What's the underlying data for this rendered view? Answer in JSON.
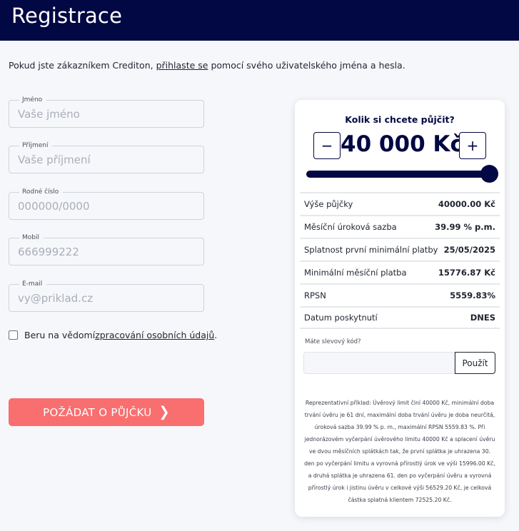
{
  "header": {
    "title": "Registrace"
  },
  "intro": {
    "before": "Pokud jste zákazníkem Crediton, ",
    "link": "přihlaste se",
    "after": " pomocí svého uživatelského jména a hesla."
  },
  "form": {
    "fields": [
      {
        "label": "Jméno",
        "placeholder": "Vaše jméno"
      },
      {
        "label": "Příjmení",
        "placeholder": "Vaše příjmení"
      },
      {
        "label": "Rodné číslo",
        "placeholder": "000000/0000"
      },
      {
        "label": "Mobil",
        "placeholder": "666999222"
      },
      {
        "label": "E-mail",
        "placeholder": "vy@priklad.cz"
      }
    ],
    "consent": {
      "before": "Beru na vědomí ",
      "link": "zpracování osobních údajů",
      "after": "."
    },
    "submit_label": "POŽÁDAT O PŮJČKU",
    "submit_chevron": "❯"
  },
  "calculator": {
    "question": "Kolik si chcete půjčit?",
    "minus": "−",
    "plus": "+",
    "amount": "40 000 Kč",
    "slider_level": 1.0,
    "rows": [
      {
        "label": "Výše půjčky",
        "value": "40000.00 Kč"
      },
      {
        "label": "Měsíční úroková sazba",
        "value": "39.99 % p.m."
      },
      {
        "label": "Splatnost první minimální platby",
        "value": "25/05/2025"
      },
      {
        "label": "Minimální měsíční platba",
        "value": "15776.87 Kč"
      },
      {
        "label": "RPSN",
        "value": "5559.83%"
      },
      {
        "label": "Datum poskytnutí",
        "value": "DNES"
      }
    ],
    "promo_label": "Máte slevový kód?",
    "promo_button": "Použít",
    "disclaimer": "Reprezentativní příklad: Úvěrový limit činí 40000 Kč, minimální doba trvání úvěru je 61 dní, maximální doba trvání úvěru je doba neurčitá, úroková sazba 39.99 % p. m., maximální RPSN 5559.83 %. Při jednorázovém vyčerpání úvěrového limitu 40000 Kč a splacení úvěru ve dvou měsíčních splátkách tak, že první splátka je uhrazena 30. den po vyčerpání limitu a vyrovná přírostlý úrok ve výši 15996.00 Kč, a druhá splátka je uhrazena 61. den po vyčerpání úvěru a vyrovná přírostlý úrok i jistinu úvěru v celkové výši 56529.20 Kč, je celková částka splatná klientem 72525.20 Kč."
  }
}
